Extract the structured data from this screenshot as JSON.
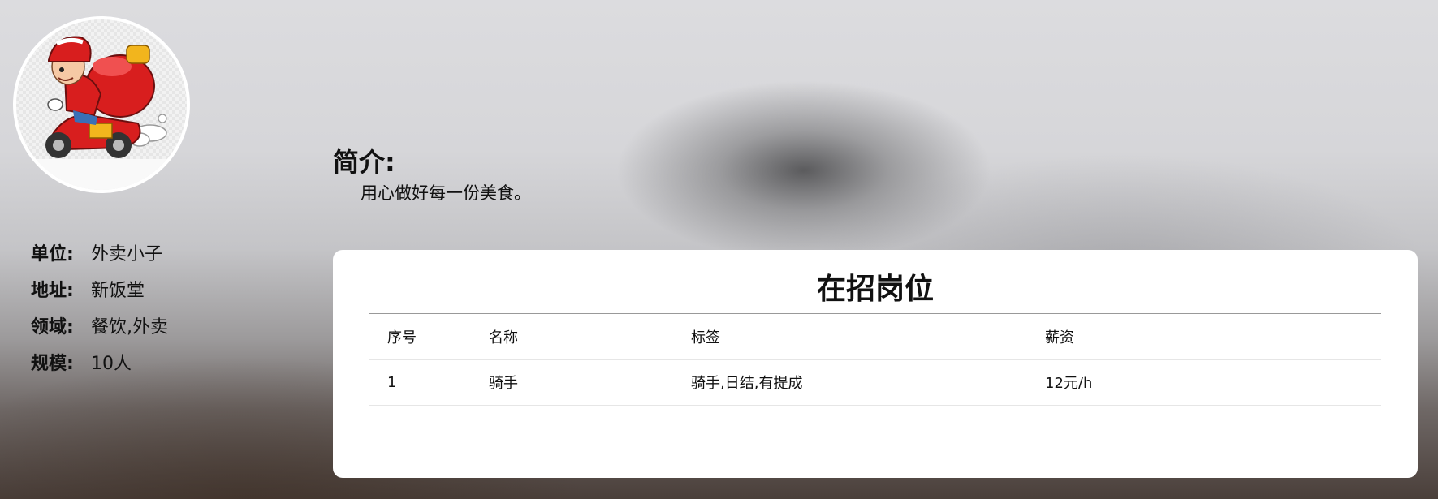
{
  "company": {
    "info": [
      {
        "label": "单位:",
        "value": "外卖小子"
      },
      {
        "label": "地址:",
        "value": "新饭堂"
      },
      {
        "label": "领域:",
        "value": "餐饮,外卖"
      },
      {
        "label": "规模:",
        "value": "10人"
      }
    ]
  },
  "intro": {
    "title": "简介:",
    "text": "用心做好每一份美食。"
  },
  "jobs": {
    "title": "在招岗位",
    "columns": [
      "序号",
      "名称",
      "标签",
      "薪资"
    ],
    "rows": [
      [
        "1",
        "骑手",
        "骑手,日结,有提成",
        "12元/h"
      ]
    ]
  },
  "icons": {
    "avatar": "delivery-rider-logo"
  },
  "colors": {
    "card_background": "#ffffff",
    "title_text": "#111111"
  }
}
